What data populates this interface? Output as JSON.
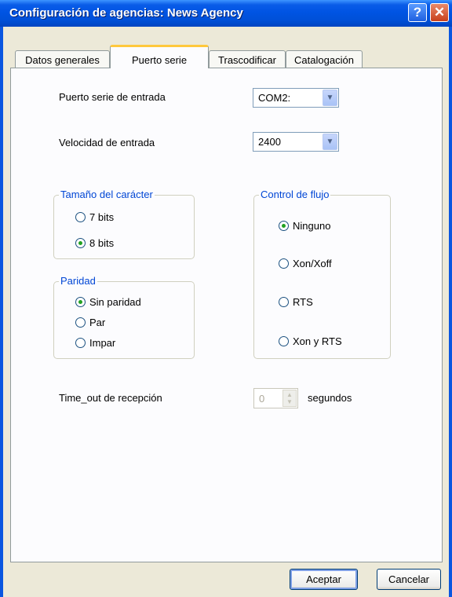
{
  "window": {
    "title": "Configuración de agencias: News Agency",
    "help_label": "?",
    "close_label": "✕"
  },
  "tabs": [
    {
      "label": "Datos generales",
      "active": false
    },
    {
      "label": "Puerto serie",
      "active": true
    },
    {
      "label": "Trascodificar",
      "active": false
    },
    {
      "label": "Catalogación",
      "active": false
    }
  ],
  "serial": {
    "input_port_label": "Puerto serie de entrada",
    "input_port_value": "COM2:",
    "speed_label": "Velocidad de entrada",
    "speed_value": "2400"
  },
  "char_size": {
    "title": "Tamaño del carácter",
    "options": [
      {
        "label": "7 bits",
        "checked": false
      },
      {
        "label": "8 bits",
        "checked": true
      }
    ]
  },
  "parity": {
    "title": "Paridad",
    "options": [
      {
        "label": "Sin paridad",
        "checked": true
      },
      {
        "label": "Par",
        "checked": false
      },
      {
        "label": "Impar",
        "checked": false
      }
    ]
  },
  "flow_control": {
    "title": "Control de flujo",
    "options": [
      {
        "label": "Ninguno",
        "checked": true
      },
      {
        "label": "Xon/Xoff",
        "checked": false
      },
      {
        "label": "RTS",
        "checked": false
      },
      {
        "label": "Xon y RTS",
        "checked": false
      }
    ]
  },
  "timeout": {
    "label": "Time_out de recepción",
    "value": "0",
    "unit": "segundos"
  },
  "buttons": {
    "ok": "Aceptar",
    "cancel": "Cancelar"
  },
  "icons": {
    "dropdown": "chevron-down-icon",
    "spin_up": "triangle-up-icon",
    "spin_down": "triangle-down-icon"
  }
}
